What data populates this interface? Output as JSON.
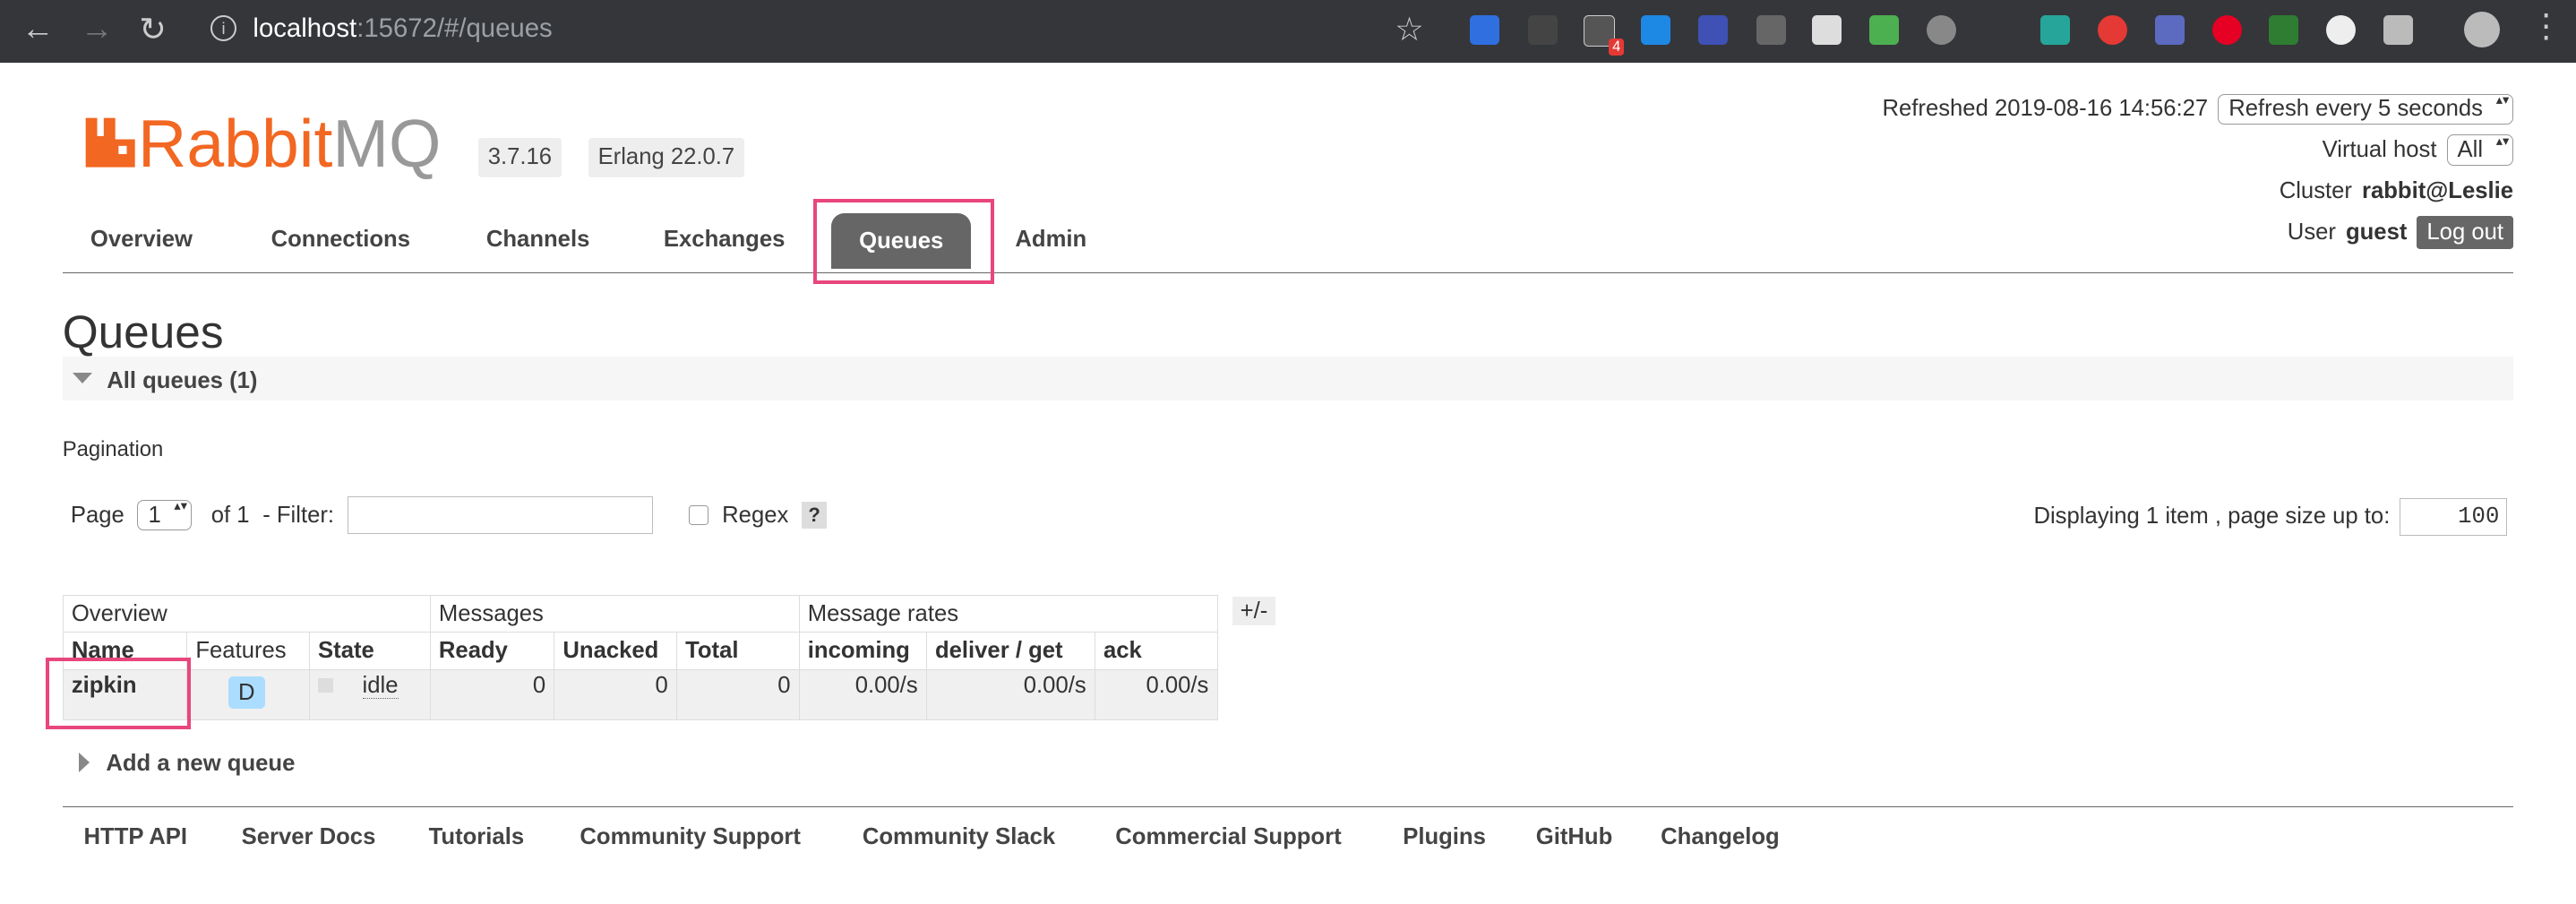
{
  "browser": {
    "url_host": "localhost",
    "url_rest": ":15672/#/queues",
    "ext_badge": "4"
  },
  "app": {
    "brand_left": "Rabbit",
    "brand_right": "MQ",
    "version": "3.7.16",
    "erlang": "Erlang 22.0.7"
  },
  "status": {
    "refreshed": "Refreshed 2019-08-16 14:56:27",
    "refresh_option": "Refresh every 5 seconds",
    "vhost_label": "Virtual host",
    "vhost_value": "All",
    "cluster_label": "Cluster",
    "cluster_value": "rabbit@Leslie",
    "user_label": "User",
    "user_value": "guest",
    "logout": "Log out"
  },
  "tabs": [
    "Overview",
    "Connections",
    "Channels",
    "Exchanges",
    "Queues",
    "Admin"
  ],
  "page_title": "Queues",
  "section": "All queues (1)",
  "pagination": {
    "label": "Pagination",
    "page": "Page",
    "page_value": "1",
    "of": "of 1",
    "filter": "- Filter:",
    "regex": "Regex",
    "help": "?",
    "displaying": "Displaying 1 item , page size up to:",
    "page_size": "100"
  },
  "table": {
    "groups": [
      "Overview",
      "Messages",
      "Message rates"
    ],
    "toggle": "+/-",
    "headers": [
      "Name",
      "Features",
      "State",
      "Ready",
      "Unacked",
      "Total",
      "incoming",
      "deliver / get",
      "ack"
    ],
    "row": {
      "name": "zipkin",
      "feature": "D",
      "state": "idle",
      "ready": "0",
      "unacked": "0",
      "total": "0",
      "incoming": "0.00/s",
      "deliver_get": "0.00/s",
      "ack": "0.00/s"
    }
  },
  "add_queue": "Add a new queue",
  "footer": [
    "HTTP API",
    "Server Docs",
    "Tutorials",
    "Community Support",
    "Community Slack",
    "Commercial Support",
    "Plugins",
    "GitHub",
    "Changelog"
  ],
  "colors": {
    "brand": "#f26722",
    "highlight": "#e8467c",
    "tab_active": "#666666"
  }
}
